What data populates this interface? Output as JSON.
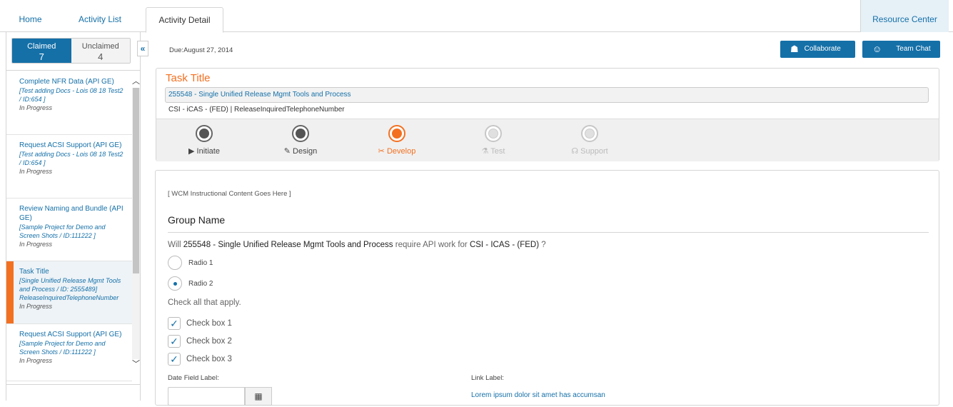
{
  "topnav": {
    "tabs": [
      {
        "label": "Home"
      },
      {
        "label": "Activity List"
      },
      {
        "label": "Activity Detail"
      }
    ],
    "resource_center": "Resource Center"
  },
  "sidebar": {
    "claimed": {
      "label": "Claimed",
      "count": "7"
    },
    "unclaimed": {
      "label": "Unclaimed",
      "count": "4"
    },
    "tasks": [
      {
        "title": "Complete NFR Data (API GE)",
        "sub": "[Test adding Docs - Lois 08 18 Test2 / ID:654 ]",
        "status": "In Progress"
      },
      {
        "title": "Request ACSI Support (API GE)",
        "sub": "[Test adding Docs - Lois 08 18 Test2 / ID:654 ]",
        "status": "In Progress"
      },
      {
        "title": "Review Naming and Bundle (API GE)",
        "sub": "[Sample Project for Demo and Screen Shots / ID:111222 ]",
        "status": "In Progress"
      },
      {
        "title": "Task Title",
        "sub": "[Single Unified Release Mgmt Tools and Process / ID: 2555489] ReleaseInquiredTelephoneNumber",
        "status": "In Progress"
      },
      {
        "title": "Request ACSI Support (API GE)",
        "sub": "[Sample Project for Demo and Screen Shots / ID:111222 ]",
        "status": "In Progress"
      }
    ]
  },
  "header": {
    "due": "Due:August 27, 2014",
    "collaborate": "Collaborate",
    "team_chat": "Team Chat"
  },
  "task": {
    "title": "Task Title",
    "name": "255548 - Single Unified Release Mgmt Tools and Process",
    "meta": "CSI - iCAS - (FED)  |  ReleaseInquiredTelephoneNumber",
    "steps": [
      {
        "label": "Initiate",
        "icon": "play-icon",
        "glyph": "▶",
        "state": "done"
      },
      {
        "label": "Design",
        "icon": "design-icon",
        "glyph": "✎",
        "state": "done"
      },
      {
        "label": "Develop",
        "icon": "tools-icon",
        "glyph": "✂",
        "state": "current"
      },
      {
        "label": "Test",
        "icon": "flask-icon",
        "glyph": "⚗",
        "state": "future"
      },
      {
        "label": "Support",
        "icon": "headset-icon",
        "glyph": "☊",
        "state": "future"
      }
    ]
  },
  "form": {
    "wcm": "[ WCM Instructional Content Goes Here ]",
    "group_name": "Group Name",
    "question_pre": "Will ",
    "question_project": "255548 - Single Unified Release Mgmt Tools and Process",
    "question_mid": " require API work for ",
    "question_csi": "CSI - ICAS - (FED)",
    "question_end": " ?",
    "radios": [
      {
        "label": "Radio 1",
        "selected": false
      },
      {
        "label": "Radio 2",
        "selected": true
      }
    ],
    "check_hint": "Check all that apply.",
    "checkboxes": [
      {
        "label": "Check box 1",
        "checked": true
      },
      {
        "label": "Check box 2",
        "checked": true
      },
      {
        "label": "Check box 3",
        "checked": true
      }
    ],
    "date_label": "Date Field Label:",
    "date_value": "",
    "link_label": "Link Label:",
    "link_text": "Lorem ipsum dolor sit amet has accumsan"
  },
  "colors": {
    "brand_blue": "#1570a8",
    "accent_orange": "#f37021"
  }
}
